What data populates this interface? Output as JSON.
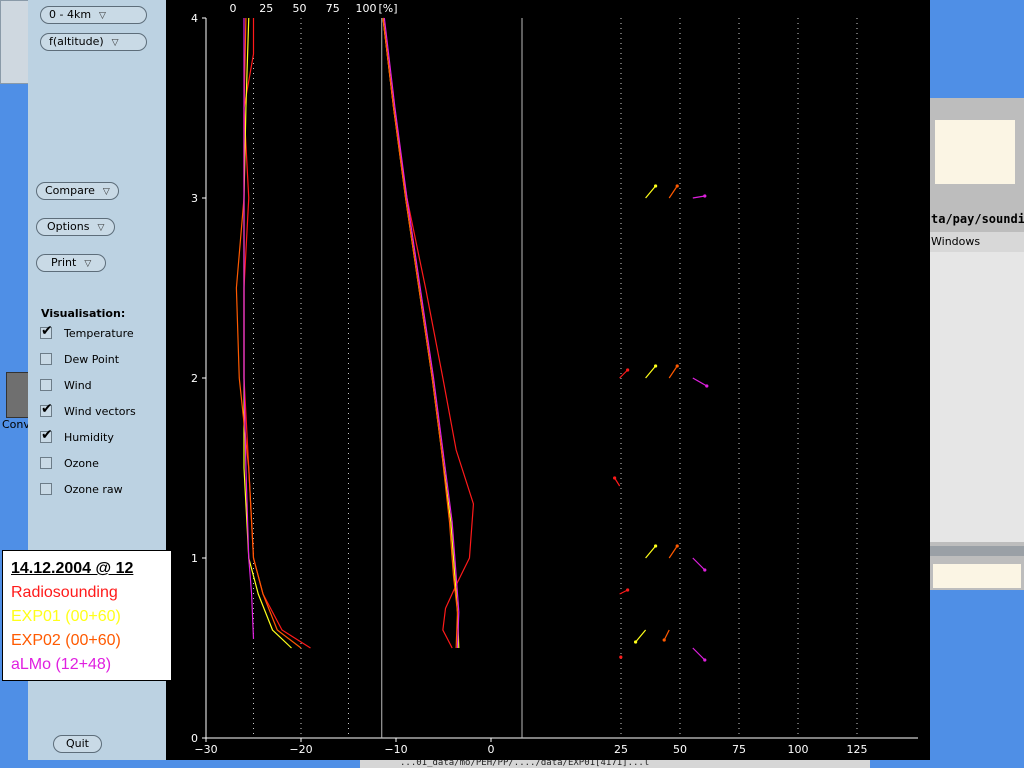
{
  "background": {
    "right_path": "ta/pay/soundir",
    "right_menu": "Windows",
    "desktop_icon_label": "Conv",
    "taskbar_text": "...01_data/mo/PEH/PP/..../data/EXP01[4171]...l"
  },
  "panel": {
    "range_select": "0 - 4km",
    "yaxis_select": "f(altitude)",
    "compare_label": "Compare",
    "options_label": "Options",
    "print_label": "Print",
    "visualisation_title": "Visualisation:",
    "checks": [
      {
        "label": "Temperature",
        "checked": true
      },
      {
        "label": "Dew Point",
        "checked": false
      },
      {
        "label": "Wind",
        "checked": false
      },
      {
        "label": "Wind vectors",
        "checked": true
      },
      {
        "label": "Humidity",
        "checked": true
      },
      {
        "label": "Ozone",
        "checked": false
      },
      {
        "label": "Ozone raw",
        "checked": false
      }
    ],
    "quit_label": "Quit"
  },
  "legend": {
    "date": "14.12.2004 @ 12",
    "entries": [
      {
        "label": "Radiosounding",
        "color": "#ff1a1a"
      },
      {
        "label": "EXP01 (00+60)",
        "color": "#ffff1a"
      },
      {
        "label": "EXP02 (00+60)",
        "color": "#ff5a00"
      },
      {
        "label": "aLMo (12+48)",
        "color": "#e020e0"
      }
    ]
  },
  "chart_data": {
    "type": "line",
    "ylabel": "",
    "ylim": [
      0,
      4
    ],
    "y_ticks": [
      "0",
      "1",
      "2",
      "3",
      "4"
    ],
    "temp_axis": {
      "xlim": [
        -30,
        10
      ],
      "ticks": [
        "−30",
        "−20",
        "−10",
        "0"
      ]
    },
    "humidity_axis": {
      "unit": "[%]",
      "ticks": [
        "0",
        "25",
        "50",
        "75",
        "100"
      ]
    },
    "wind_axis": {
      "ticks": [
        "25",
        "50",
        "75",
        "100",
        "125"
      ]
    },
    "series": [
      {
        "name": "Radiosounding",
        "color": "#ff1a1a",
        "temperature": [
          [
            -19,
            0.5
          ],
          [
            -22,
            0.6
          ],
          [
            -24,
            0.8
          ],
          [
            -25,
            1.0
          ],
          [
            -25.5,
            1.5
          ],
          [
            -26,
            2.0
          ],
          [
            -26,
            2.5
          ],
          [
            -25.5,
            3.0
          ],
          [
            -26,
            3.5
          ],
          [
            -25,
            3.8
          ],
          [
            -25,
            4.0
          ]
        ],
        "humidity": [
          [
            52,
            0.5
          ],
          [
            45,
            0.6
          ],
          [
            47,
            0.72
          ],
          [
            55,
            0.85
          ],
          [
            65,
            1.0
          ],
          [
            68,
            1.3
          ],
          [
            55,
            1.6
          ],
          [
            45,
            2.0
          ],
          [
            32,
            2.5
          ],
          [
            18,
            3.0
          ],
          [
            8,
            3.5
          ],
          [
            0,
            4.0
          ]
        ],
        "wind": [
          [
            4.5,
            0.45,
            0,
            0.1
          ],
          [
            4,
            0.8,
            8,
            -4
          ],
          [
            4,
            1.4,
            -5,
            -8
          ],
          [
            4,
            2.0,
            8,
            -8
          ]
        ]
      },
      {
        "name": "EXP01 (00+60)",
        "color": "#ffff1a",
        "temperature": [
          [
            -21,
            0.5
          ],
          [
            -23,
            0.6
          ],
          [
            -24.5,
            0.8
          ],
          [
            -25.5,
            1.0
          ],
          [
            -26,
            1.5
          ],
          [
            -26,
            2.0
          ],
          [
            -26,
            2.5
          ],
          [
            -26,
            3.0
          ],
          [
            -25.8,
            3.5
          ],
          [
            -25.5,
            4.0
          ]
        ],
        "humidity": [
          [
            57,
            0.5
          ],
          [
            56,
            0.7
          ],
          [
            54,
            0.9
          ],
          [
            51,
            1.2
          ],
          [
            44,
            1.6
          ],
          [
            37,
            2.0
          ],
          [
            27,
            2.5
          ],
          [
            17,
            3.0
          ],
          [
            8,
            3.5
          ],
          [
            0,
            4.0
          ]
        ],
        "wind": [
          [
            15,
            0.6,
            -10,
            12
          ],
          [
            15,
            1.0,
            10,
            -12
          ],
          [
            15,
            2.0,
            10,
            -12
          ],
          [
            15,
            3.0,
            10,
            -12
          ]
        ]
      },
      {
        "name": "EXP02 (00+60)",
        "color": "#ff5a00",
        "temperature": [
          [
            -20,
            0.5
          ],
          [
            -22.5,
            0.6
          ],
          [
            -24,
            0.8
          ],
          [
            -25,
            1.0
          ],
          [
            -25.5,
            1.5
          ],
          [
            -26.5,
            2.0
          ],
          [
            -26.8,
            2.5
          ],
          [
            -26,
            3.0
          ],
          [
            -26,
            3.5
          ],
          [
            -25.8,
            4.0
          ]
        ],
        "humidity": [
          [
            55,
            0.5
          ],
          [
            56,
            0.7
          ],
          [
            53,
            0.9
          ],
          [
            50,
            1.2
          ],
          [
            44,
            1.6
          ],
          [
            37,
            2.0
          ],
          [
            27,
            2.5
          ],
          [
            17,
            3.0
          ],
          [
            8,
            3.5
          ],
          [
            0,
            4.0
          ]
        ],
        "wind": [
          [
            25,
            0.6,
            -5,
            10
          ],
          [
            25,
            1.0,
            8,
            -12
          ],
          [
            25,
            2.0,
            8,
            -12
          ],
          [
            25,
            3.0,
            8,
            -12
          ]
        ]
      },
      {
        "name": "aLMo (12+48)",
        "color": "#e020e0",
        "temperature": [
          [
            -25,
            0.55
          ],
          [
            -25.2,
            0.8
          ],
          [
            -25.5,
            1.0
          ],
          [
            -25.8,
            1.5
          ],
          [
            -26,
            2.0
          ],
          [
            -26,
            2.5
          ],
          [
            -26,
            3.0
          ],
          [
            -26,
            3.5
          ],
          [
            -26,
            4.0
          ]
        ],
        "humidity": [
          [
            56,
            0.5
          ],
          [
            57,
            0.7
          ],
          [
            55,
            0.9
          ],
          [
            52,
            1.2
          ],
          [
            45,
            1.6
          ],
          [
            38,
            2.0
          ],
          [
            28,
            2.5
          ],
          [
            18,
            3.0
          ],
          [
            9,
            3.5
          ],
          [
            1,
            4.0
          ]
        ],
        "wind": [
          [
            35,
            0.5,
            12,
            12
          ],
          [
            35,
            1.0,
            12,
            12
          ],
          [
            35,
            2.0,
            14,
            8
          ],
          [
            35,
            3.0,
            12,
            -2
          ]
        ]
      }
    ]
  }
}
